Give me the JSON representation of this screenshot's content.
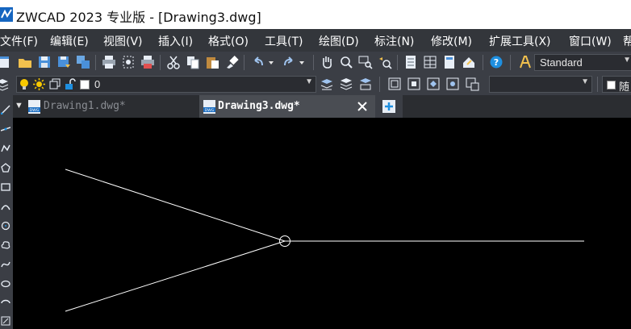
{
  "app": {
    "title": "ZWCAD 2023 专业版 - [Drawing3.dwg]"
  },
  "menu": [
    {
      "label": "文件(F)"
    },
    {
      "label": "编辑(E)"
    },
    {
      "label": "视图(V)"
    },
    {
      "label": "插入(I)"
    },
    {
      "label": "格式(O)"
    },
    {
      "label": "工具(T)"
    },
    {
      "label": "绘图(D)"
    },
    {
      "label": "标注(N)"
    },
    {
      "label": "修改(M)"
    },
    {
      "label": "扩展工具(X)"
    },
    {
      "label": "窗口(W)"
    }
  ],
  "toolbar": {
    "text_style": "Standard",
    "layer_name": "0",
    "linetype_value": "",
    "overflow_label": "随"
  },
  "tabs": [
    {
      "label": "Drawing1.dwg*",
      "active": false
    },
    {
      "label": "Drawing3.dwg*",
      "active": true
    }
  ],
  "colors": {
    "accent": "#1e8fe0",
    "canvas": "#000000",
    "lines": "#ffffff",
    "bulb": "#f7c800"
  }
}
